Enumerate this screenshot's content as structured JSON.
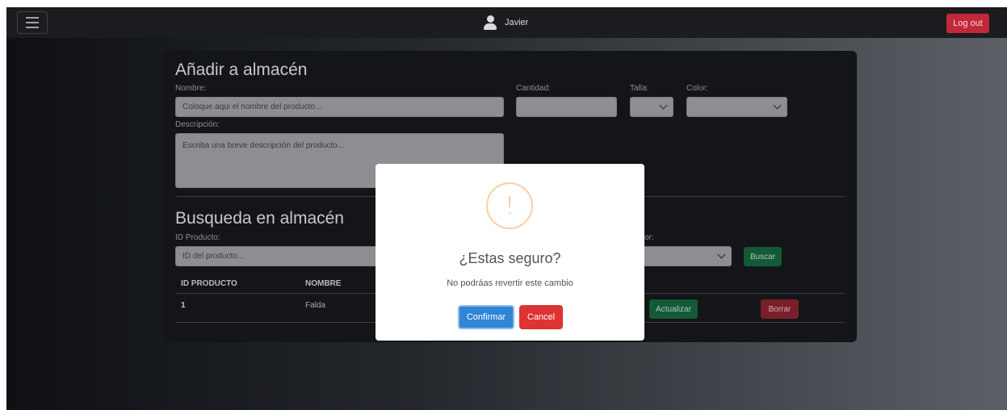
{
  "navbar": {
    "user_name": "Javier",
    "logout_label": "Log out"
  },
  "add_form": {
    "title": "Añadir a almacén",
    "name_label": "Nombre:",
    "name_placeholder": "Coloque aqui el nombre del producto...",
    "quantity_label": "Cantidad:",
    "size_label": "Talla:",
    "color_label": "Color:",
    "description_label": "Descripción:",
    "description_placeholder": "Escriba una breve descripción del producto..."
  },
  "search_form": {
    "title": "Busqueda en almacén",
    "id_label": "ID Producto:",
    "id_placeholder": "ID del producto...",
    "partial_label": "or:",
    "search_label": "Buscar"
  },
  "table": {
    "headers": [
      "ID PRODUCTO",
      "NOMBRE"
    ],
    "rows": [
      {
        "id": "1",
        "name": "Falda",
        "update_label": "Actualizar",
        "delete_label": "Borrar"
      }
    ]
  },
  "modal": {
    "icon": "!",
    "title": "¿Estas seguro?",
    "text": "No podráas revertir este cambio",
    "confirm_label": "Confirmar",
    "cancel_label": "Cancel"
  },
  "colors": {
    "confirm": "#3085d6",
    "cancel": "#dd3333",
    "logout": "#c3283a",
    "warning": "#f8bb86"
  }
}
